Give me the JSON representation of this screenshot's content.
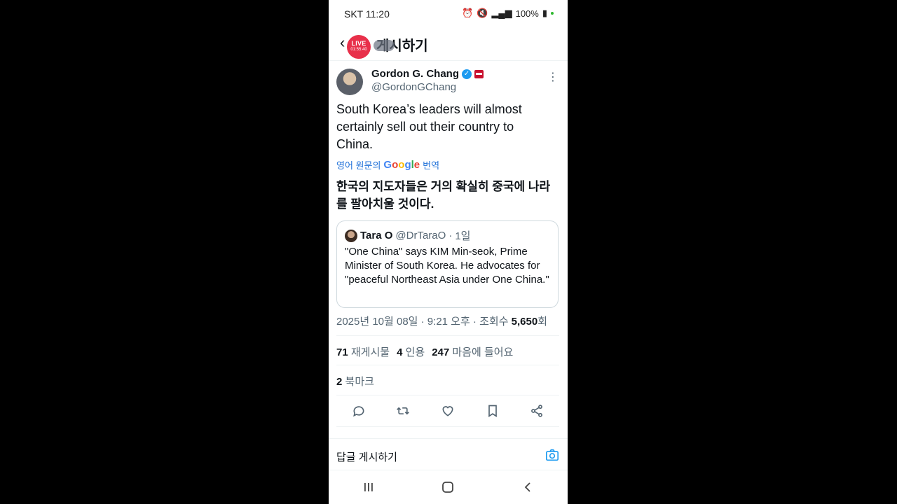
{
  "status_bar": {
    "carrier_time": "SKT 11:20",
    "battery": "100%"
  },
  "header": {
    "title": "게시하기",
    "live_label": "LIVE",
    "live_time": "01:55:40"
  },
  "author": {
    "name": "Gordon G. Chang",
    "handle": "@GordonGChang"
  },
  "tweet": {
    "text": "South Korea’s leaders will almost certainly sell out their country to China.",
    "translate_prefix": "영어 원문의",
    "google_word": [
      "G",
      "o",
      "o",
      "g",
      "l",
      "e"
    ],
    "translate_suffix": "번역",
    "translated_text": "한국의 지도자들은 거의 확실히 중국에 나라를 팔아치울 것이다."
  },
  "quote": {
    "name": "Tara O",
    "handle": "@DrTaraO",
    "dot": "·",
    "age": "1일",
    "text": "\"One China\" says KIM Min-seok, Prime Minister of South Korea. He advocates for \"peaceful Northeast Asia under One China.\""
  },
  "meta": {
    "datetime": "2025년 10월 08일 · 9:21 오후 · 조회수 ",
    "views": "5,650",
    "views_suffix": "회"
  },
  "stats": {
    "reposts_count": "71",
    "reposts_label": "재게시물",
    "quotes_count": "4",
    "quotes_label": "인용",
    "likes_count": "247",
    "likes_label": "마음에 들어요",
    "bookmarks_count": "2",
    "bookmarks_label": "북마크"
  },
  "reply": {
    "placeholder": "답글 게시하기"
  },
  "icons": [
    "back-arrow-icon",
    "more-icon",
    "reply-icon",
    "repost-icon",
    "like-icon",
    "bookmark-icon",
    "share-icon",
    "camera-icon",
    "recents-icon",
    "home-icon",
    "back-nav-icon"
  ]
}
